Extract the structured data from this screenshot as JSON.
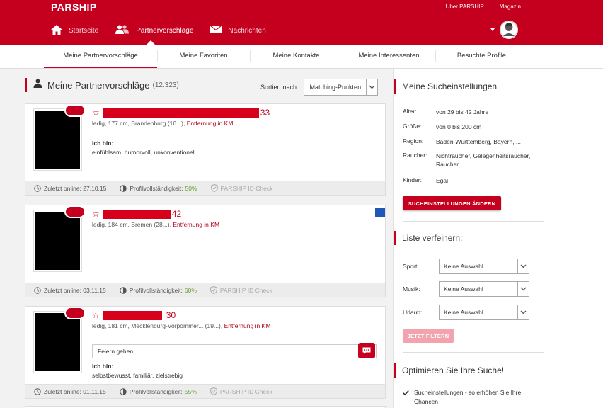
{
  "header": {
    "logo": "PARSHIP",
    "top_links": [
      "Über PARSHIP",
      "Magazin"
    ],
    "nav": [
      {
        "label": "Startseite",
        "icon": "home-icon"
      },
      {
        "label": "Partnervorschläge",
        "icon": "people-icon"
      },
      {
        "label": "Nachrichten",
        "icon": "envelope-icon"
      }
    ],
    "active_nav": "Partnervorschläge"
  },
  "subnav": {
    "tabs": [
      "Meine Partnervorschläge",
      "Meine Favoriten",
      "Meine Kontakte",
      "Meine Interessenten",
      "Besuchte Profile"
    ],
    "active": "Meine Partnervorschläge"
  },
  "suggestions": {
    "title": "Meine Partnervorschläge",
    "count": "(12.323)",
    "sort_label": "Sortiert nach:",
    "sort_value": "Matching-Punkten",
    "cards": [
      {
        "age": "33",
        "details": "ledig, 177 cm, Brandenburg (16...),",
        "distance": "Entfernung in KM",
        "ichbin_label": "Ich bin:",
        "ichbin": "einfühlsam, humorvoll, unkonventionell",
        "last_online": "Zuletzt online: 27.10.15",
        "profile_label": "Profilvollständigkeit:",
        "profile_pct": "50%",
        "id_check": "PARSHIP ID Check"
      },
      {
        "age": "42",
        "details": "ledig, 184 cm, Bremen (28...),",
        "distance": "Entfernung in KM",
        "last_online": "Zuletzt online: 03.11.15",
        "profile_label": "Profilvollständigkeit:",
        "profile_pct": "60%",
        "id_check": "PARSHIP ID Check"
      },
      {
        "age": "30",
        "details": "ledig, 181 cm, Mecklenburg-Vorpommer... (19...),",
        "distance": "Entfernung in KM",
        "message": "Feiern gehen",
        "ichbin_label": "Ich bin:",
        "ichbin": "selbstbewusst, familiär, zielstrebig",
        "last_online": "Zuletzt online: 01.11.15",
        "profile_label": "Profilvollständigkeit:",
        "profile_pct": "55%",
        "id_check": "PARSHIP ID Check"
      }
    ]
  },
  "search_settings": {
    "title": "Meine Sucheinstellungen",
    "rows": [
      {
        "key": "Alter:",
        "value": "von 29 bis 42 Jahre"
      },
      {
        "key": "Größe:",
        "value": "von 0 bis 200 cm"
      },
      {
        "key": "Region:",
        "value": "Baden-Württemberg, Bayern, ..."
      },
      {
        "key": "Raucher:",
        "value": "Nichtraucher, Gelegenheitsraucher, Raucher"
      },
      {
        "key": "Kinder:",
        "value": "Egal"
      }
    ],
    "button": "SUCHEINSTELLUNGEN ÄNDERN"
  },
  "refine": {
    "title": "Liste verfeinern:",
    "filters": [
      {
        "key": "Sport:",
        "value": "Keine Auswahl"
      },
      {
        "key": "Musik:",
        "value": "Keine Auswahl"
      },
      {
        "key": "Urlaub:",
        "value": "Keine Auswahl"
      }
    ],
    "button": "JETZT FILTERN"
  },
  "optimize": {
    "title": "Optimieren Sie Ihre Suche!",
    "tip": "Sucheinstellungen - so erhöhen Sie Ihre Chancen"
  },
  "colors": {
    "brand": "#c5001f",
    "complete": "#6a9b2f",
    "bookmark": "#1f56b8"
  }
}
